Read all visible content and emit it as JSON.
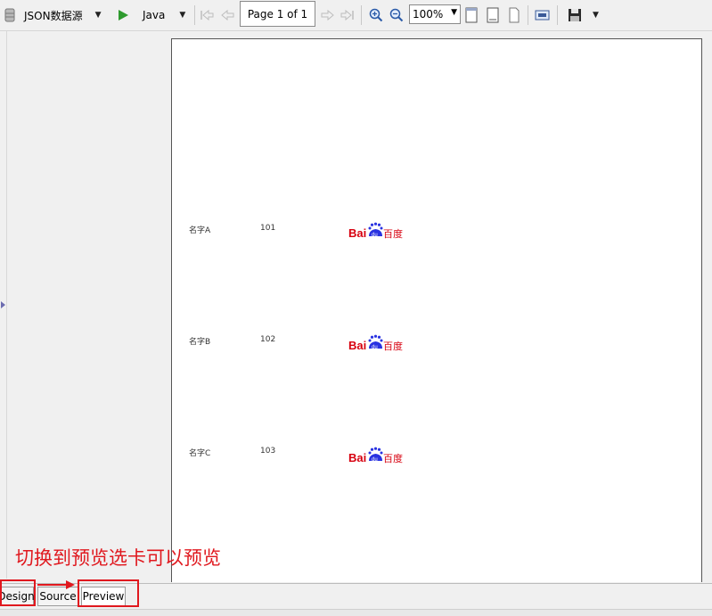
{
  "toolbar": {
    "datasource_label": "JSON数据源",
    "language_label": "Java",
    "page_label": "Page 1 of 1",
    "zoom_value": "100%"
  },
  "report_rows": [
    {
      "name": "名字A",
      "id": "101",
      "logo": "Bai百度"
    },
    {
      "name": "名字B",
      "id": "102",
      "logo": "Bai百度"
    },
    {
      "name": "名字C",
      "id": "103",
      "logo": "Bai百度"
    }
  ],
  "logo_parts": {
    "latin": "Bai",
    "paw": "du",
    "cn": "百度"
  },
  "annotation": "切换到预览选卡可以预览",
  "tabs": {
    "design": "Design",
    "source": "Source",
    "preview": "Preview"
  },
  "colors": {
    "accent_red": "#e0181e",
    "baidu_red": "#d7000f",
    "baidu_blue": "#2932e1"
  },
  "icons": [
    "database-icon",
    "play-icon",
    "first-page-icon",
    "prev-page-icon",
    "next-page-icon",
    "last-page-icon",
    "zoom-in-icon",
    "zoom-out-icon",
    "fit-page-icon",
    "fit-width-icon",
    "actual-size-icon",
    "export-icon",
    "save-icon"
  ]
}
